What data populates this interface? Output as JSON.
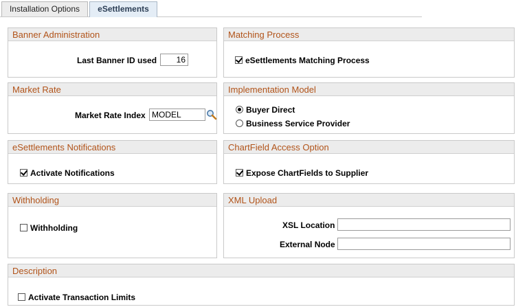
{
  "tabs": [
    {
      "label": "Installation Options",
      "active": false
    },
    {
      "label": "eSettlements",
      "active": true
    }
  ],
  "banner_admin": {
    "title": "Banner Administration",
    "last_banner_label": "Last Banner ID used",
    "last_banner_value": "16"
  },
  "matching": {
    "title": "Matching Process",
    "checkbox_label": "eSettlements Matching Process",
    "checked": true
  },
  "market_rate": {
    "title": "Market Rate",
    "index_label": "Market Rate Index",
    "index_value": "MODEL",
    "lookup_icon": "magnifier-icon"
  },
  "implementation": {
    "title": "Implementation Model",
    "options": [
      {
        "label": "Buyer Direct",
        "selected": true
      },
      {
        "label": "Business Service Provider",
        "selected": false
      }
    ]
  },
  "notifications": {
    "title": "eSettlements Notifications",
    "checkbox_label": "Activate Notifications",
    "checked": true
  },
  "chartfield": {
    "title": "ChartField Access Option",
    "checkbox_label": "Expose ChartFields to Supplier",
    "checked": true
  },
  "withholding": {
    "title": "Withholding",
    "checkbox_label": "Withholding",
    "checked": false
  },
  "xml_upload": {
    "title": "XML Upload",
    "xsl_label": "XSL Location",
    "xsl_value": "",
    "node_label": "External Node",
    "node_value": ""
  },
  "description": {
    "title": "Description",
    "checkbox_label": "Activate Transaction Limits",
    "checked": false
  },
  "colors": {
    "section_header_text": "#b15319",
    "section_header_bg": "#ececec",
    "active_tab_bg": "#e4edf6"
  }
}
